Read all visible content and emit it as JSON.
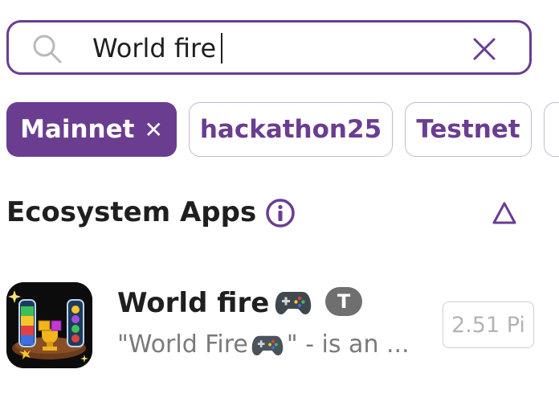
{
  "search": {
    "value": "World fire",
    "icon": "search-icon",
    "clear_icon": "close-icon"
  },
  "chips": [
    {
      "label": "Mainnet",
      "active": true,
      "remove_icon": "close-icon"
    },
    {
      "label": "hackathon25",
      "active": false
    },
    {
      "label": "Testnet",
      "active": false
    }
  ],
  "section": {
    "title": "Ecosystem Apps",
    "info_icon": "info-icon",
    "collapse_icon": "triangle-up-icon"
  },
  "app": {
    "name": "World fire",
    "title_icon": "gamepad-icon",
    "badge": "T",
    "description_prefix": "\"World Fire",
    "description_suffix": "\" - is an ...",
    "price": "2.51 Pi"
  },
  "colors": {
    "accent": "#6a3d91",
    "chip_border": "#c8b6d6",
    "text": "#1f1f1f",
    "muted": "#7a7a7a",
    "badge": "#6f6f6f"
  }
}
